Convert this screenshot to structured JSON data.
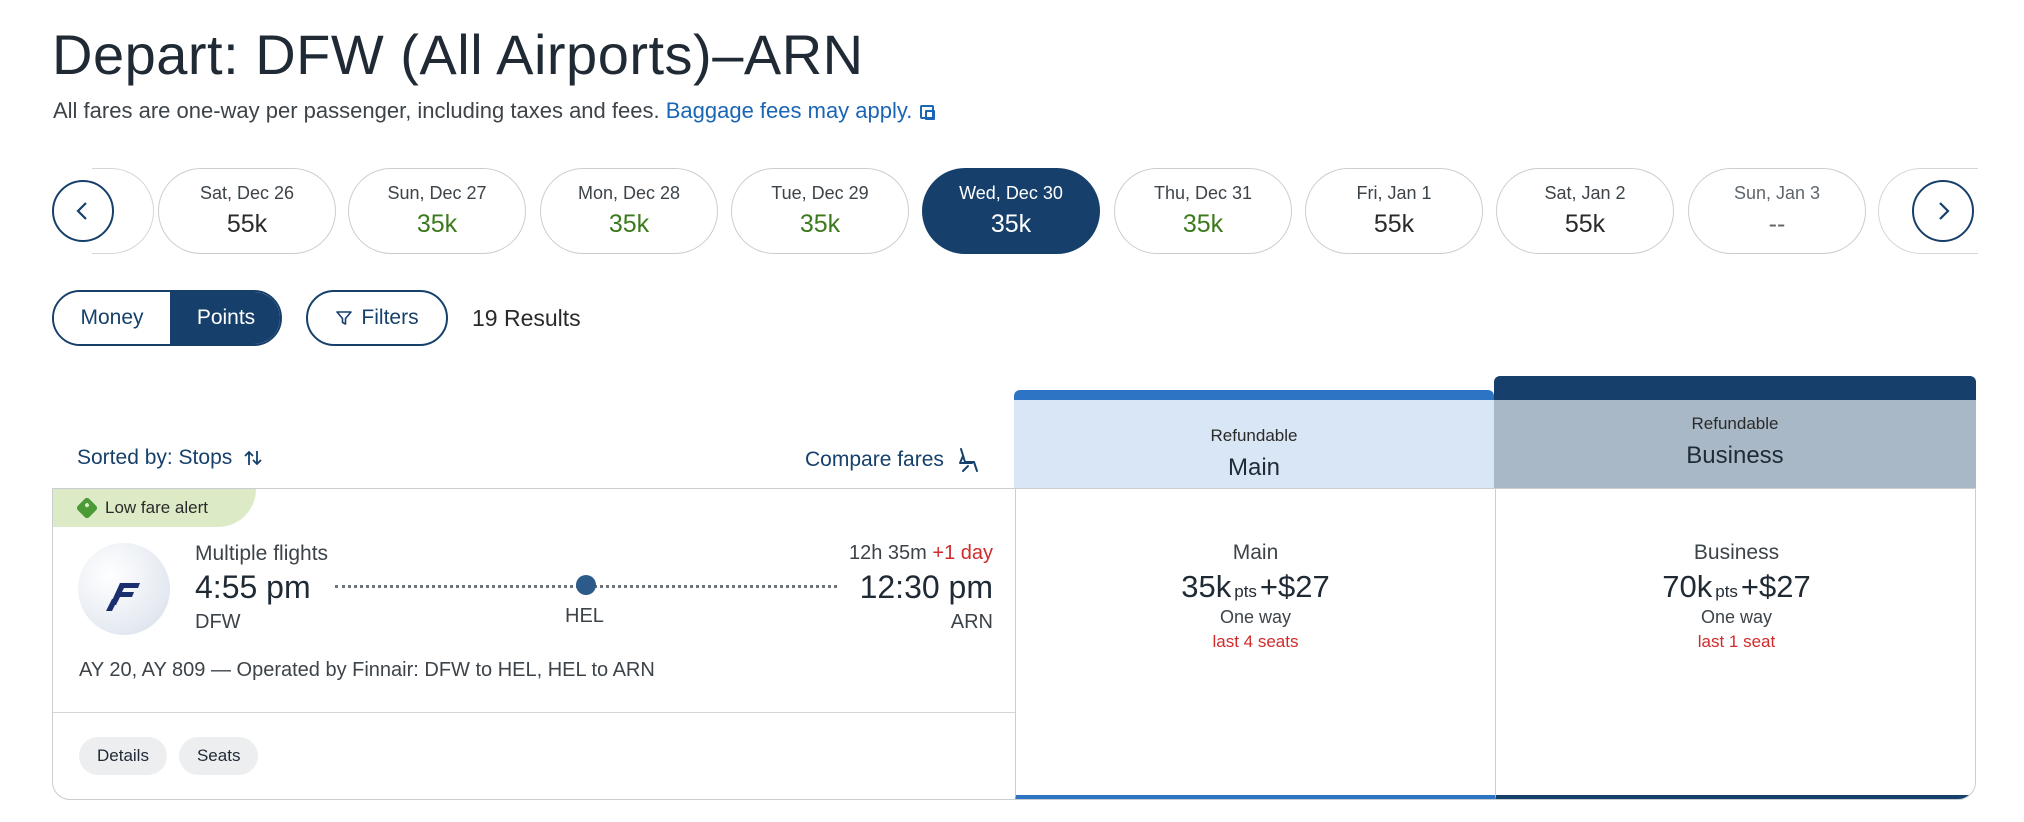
{
  "header": {
    "title": "Depart: DFW (All Airports)–ARN",
    "subtitle": "All fares are one-way per passenger, including taxes and fees.",
    "baggage_link": "Baggage fees may apply."
  },
  "dates": [
    {
      "day": "Sat, Dec 26",
      "price": "55k",
      "color": "default"
    },
    {
      "day": "Sun, Dec 27",
      "price": "35k",
      "color": "green"
    },
    {
      "day": "Mon, Dec 28",
      "price": "35k",
      "color": "green"
    },
    {
      "day": "Tue, Dec 29",
      "price": "35k",
      "color": "green"
    },
    {
      "day": "Wed, Dec 30",
      "price": "35k",
      "color": "selected"
    },
    {
      "day": "Thu, Dec 31",
      "price": "35k",
      "color": "green"
    },
    {
      "day": "Fri, Jan 1",
      "price": "55k",
      "color": "default"
    },
    {
      "day": "Sat, Jan 2",
      "price": "55k",
      "color": "default"
    },
    {
      "day": "Sun, Jan 3",
      "price": "--",
      "color": "disabled"
    }
  ],
  "toggle": {
    "money": "Money",
    "points": "Points"
  },
  "filters_label": "Filters",
  "results_count": "19 Results",
  "sort": {
    "label": "Sorted by: Stops",
    "compare": "Compare fares"
  },
  "fare_columns": {
    "main": {
      "kind": "Refundable",
      "name": "Main"
    },
    "business": {
      "kind": "Refundable",
      "name": "Business"
    }
  },
  "flight": {
    "alert": "Low fare alert",
    "multiple": "Multiple flights",
    "dep_time": "4:55 pm",
    "dep_code": "DFW",
    "stop": "HEL",
    "duration": "12h 35m",
    "plus_day": "+1 day",
    "arr_time": "12:30 pm",
    "arr_code": "ARN",
    "operated": "AY 20, AY 809 — Operated by Finnair: DFW to HEL, HEL to ARN",
    "chips": {
      "details": "Details",
      "seats": "Seats"
    },
    "fares": {
      "main": {
        "cabin": "Main",
        "points": "35k",
        "pts": "pts",
        "cash": "+$27",
        "oneway": "One way",
        "seats": "last 4 seats"
      },
      "business": {
        "cabin": "Business",
        "points": "70k",
        "pts": "pts",
        "cash": "+$27",
        "oneway": "One way",
        "seats": "last 1 seat"
      }
    }
  },
  "colors": {
    "brand_navy": "#16406b",
    "accent_blue": "#2d74c4",
    "green_price": "#3b7a1c",
    "alert_red": "#d12a2a"
  }
}
